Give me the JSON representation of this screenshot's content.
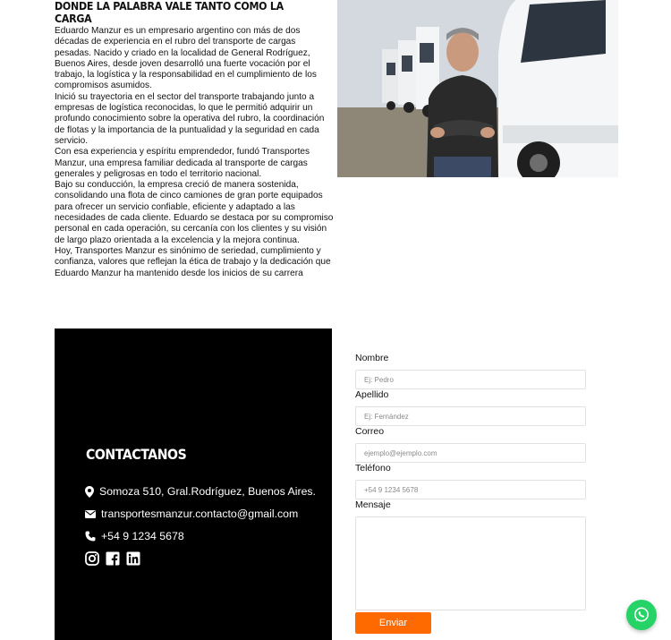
{
  "about": {
    "heading": "Donde la palabra vale tanto como la carga",
    "paragraphs": [
      "Eduardo Manzur es un empresario argentino con más de dos décadas de experiencia en el rubro del transporte de cargas pesadas. Nacido y criado en la localidad de General Rodríguez, Buenos Aires, desde joven desarrolló una fuerte vocación por el trabajo, la logística y la responsabilidad en el cumplimiento de los compromisos asumidos.",
      "Inició su trayectoria en el sector del transporte trabajando junto a empresas de logística reconocidas, lo que le permitió adquirir un profundo conocimiento sobre la operativa del rubro, la coordinación de flotas y la importancia de la puntualidad y la seguridad en cada servicio.",
      "Con esa experiencia y espíritu emprendedor, fundó Transportes Manzur, una empresa familiar dedicada al transporte de cargas generales y peligrosas en todo el territorio nacional.",
      "Bajo su conducción, la empresa creció de manera sostenida, consolidando una flota de cinco camiones de gran porte equipados para ofrecer un servicio confiable, eficiente y adaptado a las necesidades de cada cliente. Eduardo se destaca por su compromiso personal en cada operación, su cercanía con los clientes y su visión de largo plazo orientada a la excelencia y la mejora continua.",
      "Hoy, Transportes Manzur es sinónimo de seriedad, cumplimiento y confianza, valores que reflejan la ética de trabajo y la dedicación que Eduardo Manzur ha mantenido desde los inicios de su carrera"
    ]
  },
  "contact": {
    "title": "Contactanos",
    "address": "Somoza 510, Gral.Rodríguez, Buenos Aires.",
    "email": "transportesmanzur.contacto@gmail.com",
    "phone": "+54 9 1234 5678",
    "social_icons": [
      "instagram-icon",
      "facebook-icon",
      "linkedin-icon"
    ]
  },
  "form": {
    "fields": [
      {
        "label": "Nombre",
        "placeholder": "Ej: Pedro"
      },
      {
        "label": "Apellido",
        "placeholder": "Ej: Fernández"
      },
      {
        "label": "Correo",
        "placeholder": "ejemplo@ejemplo.com"
      },
      {
        "label": "Teléfono",
        "placeholder": "+54 9 1234 5678"
      }
    ],
    "message_label": "Mensaje",
    "submit_label": "Enviar"
  },
  "colors": {
    "accent": "#ff6a00",
    "panel": "#000000",
    "whatsapp": "#25d366"
  }
}
